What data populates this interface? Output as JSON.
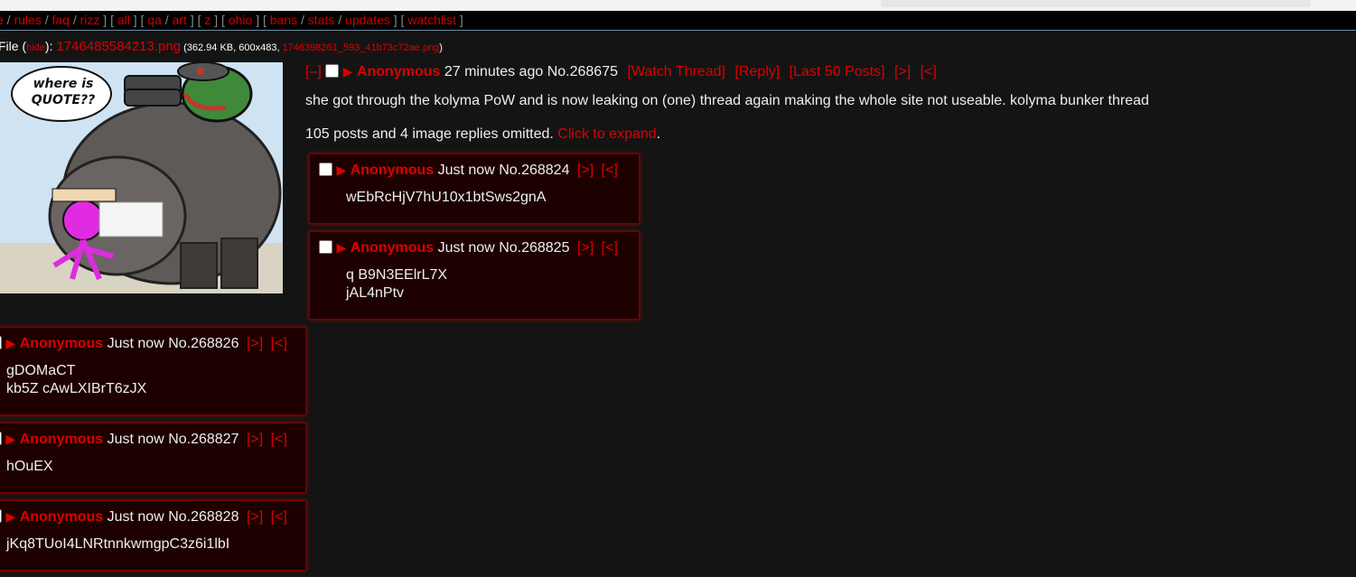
{
  "navbar": {
    "items": [
      {
        "kind": "link",
        "text": "e"
      },
      {
        "kind": "sep",
        "text": " / "
      },
      {
        "kind": "link",
        "text": "rules"
      },
      {
        "kind": "sep",
        "text": " / "
      },
      {
        "kind": "link",
        "text": "faq"
      },
      {
        "kind": "sep",
        "text": " / "
      },
      {
        "kind": "link",
        "text": "rizz"
      },
      {
        "kind": "sep",
        "text": " ] [ "
      },
      {
        "kind": "link",
        "text": "all"
      },
      {
        "kind": "sep",
        "text": " ] [ "
      },
      {
        "kind": "link",
        "text": "qa"
      },
      {
        "kind": "sep",
        "text": " / "
      },
      {
        "kind": "link",
        "text": "art"
      },
      {
        "kind": "sep",
        "text": " ] [ "
      },
      {
        "kind": "link",
        "text": "z"
      },
      {
        "kind": "sep",
        "text": " ] [ "
      },
      {
        "kind": "link",
        "text": "ohio"
      },
      {
        "kind": "sep",
        "text": " ] [ "
      },
      {
        "kind": "link",
        "text": "bans"
      },
      {
        "kind": "sep",
        "text": " / "
      },
      {
        "kind": "link",
        "text": "stats"
      },
      {
        "kind": "sep",
        "text": " / "
      },
      {
        "kind": "link",
        "text": "updates"
      },
      {
        "kind": "sep",
        "text": " ] [ "
      },
      {
        "kind": "link",
        "text": "watchlist"
      },
      {
        "kind": "sep",
        "text": " ]"
      }
    ]
  },
  "file": {
    "prefix": "File (",
    "hide": "hide",
    "mid": "): ",
    "filename": "1746485584213.png",
    "meta_open": " (362.94 KB, 600x483, ",
    "original_name": "1746398261_593_41b73c72ae.png",
    "meta_close": ")"
  },
  "image": {
    "quote_label": "where is\nQUOTE??"
  },
  "op": {
    "collapse": "[–]",
    "arrow": "▶",
    "name": "Anonymous",
    "time": "27 minutes ago",
    "number": "No.268675",
    "links": [
      "[Watch Thread]",
      "[Reply]",
      "[Last 50 Posts]",
      "[>]",
      "[<]"
    ],
    "text": "she got through the kolyma PoW and is now leaking on (one) thread again making the whole site not useable. kolyma bunker thread",
    "omitted": "105 posts and 4 image replies omitted.",
    "expand": "Click to expand",
    "expand_tail": "."
  },
  "replies": [
    {
      "name": "Anonymous",
      "time": "Just now",
      "number": "No.268824",
      "next": "[>]",
      "prev": "[<]",
      "lines": [
        "wEbRcHjV7hU10x1btSws2gnA"
      ]
    },
    {
      "name": "Anonymous",
      "time": "Just now",
      "number": "No.268825",
      "next": "[>]",
      "prev": "[<]",
      "lines": [
        "q B9N3EElrL7X",
        "jAL4nPtv"
      ]
    },
    {
      "name": "Anonymous",
      "time": "Just now",
      "number": "No.268826",
      "next": "[>]",
      "prev": "[<]",
      "lines": [
        "gDOMaCT",
        "kb5Z cAwLXIBrT6zJX"
      ]
    },
    {
      "name": "Anonymous",
      "time": "Just now",
      "number": "No.268827",
      "next": "[>]",
      "prev": "[<]",
      "lines": [
        "hOuEX"
      ]
    },
    {
      "name": "Anonymous",
      "time": "Just now",
      "number": "No.268828",
      "next": "[>]",
      "prev": "[<]",
      "lines": [
        "jKq8TUoI4LNRtnnkwmgpC3z6i1lbI"
      ]
    }
  ],
  "colors": {
    "accent": "#dd0000",
    "background": "#141414",
    "reply_bg": "#1d0000"
  }
}
